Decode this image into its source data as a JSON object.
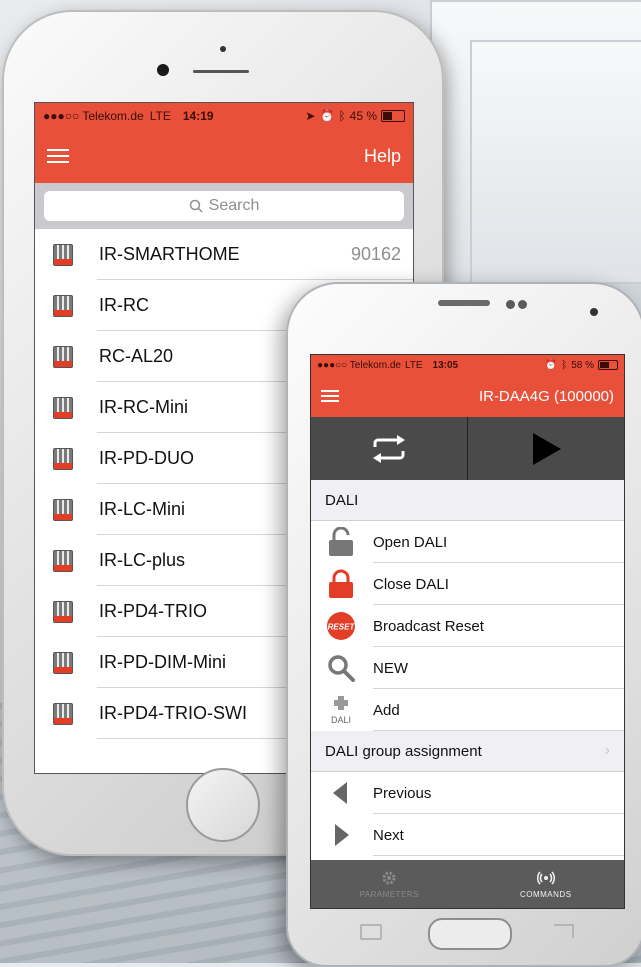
{
  "iphone": {
    "status": {
      "carrier": "●●●○○ Telekom.de",
      "network": "LTE",
      "time": "14:19",
      "battery": "45 %",
      "battery_level": 0.45
    },
    "nav": {
      "help": "Help"
    },
    "search": {
      "placeholder": "Search"
    },
    "list": [
      {
        "label": "IR-SMARTHOME",
        "count": "90162"
      },
      {
        "label": "IR-RC"
      },
      {
        "label": "RC-AL20"
      },
      {
        "label": "IR-RC-Mini"
      },
      {
        "label": "IR-PD-DUO"
      },
      {
        "label": "IR-LC-Mini"
      },
      {
        "label": "IR-LC-plus"
      },
      {
        "label": "IR-PD4-TRIO"
      },
      {
        "label": "IR-PD-DIM-Mini"
      },
      {
        "label": "IR-PD4-TRIO-SWI"
      }
    ]
  },
  "galaxy": {
    "status": {
      "carrier": "●●●○○ Telekom.de",
      "network": "LTE",
      "time": "13:05",
      "battery": "58 %",
      "battery_level": 0.58
    },
    "nav": {
      "title": "IR-DAA4G (100000)"
    },
    "section_dali": "DALI",
    "items": [
      {
        "label": "Open DALI",
        "icon": "lock-open-icon"
      },
      {
        "label": "Close DALI",
        "icon": "lock-closed-icon"
      },
      {
        "label": "Broadcast Reset",
        "icon": "reset-icon",
        "icon_text": "RESET"
      },
      {
        "label": "NEW",
        "icon": "search-icon"
      },
      {
        "label": "Add",
        "icon": "add-dali-icon",
        "icon_text": "DALI"
      }
    ],
    "section_group": "DALI group assignment",
    "nav_items": [
      {
        "label": "Previous",
        "icon": "triangle-left-icon"
      },
      {
        "label": "Next",
        "icon": "triangle-right-icon"
      }
    ],
    "tabs": [
      {
        "label": "PARAMETERS",
        "icon": "gear-icon"
      },
      {
        "label": "COMMANDS",
        "icon": "broadcast-icon"
      }
    ],
    "colors": {
      "accent": "#e8503a",
      "dark": "#4a4a4a"
    }
  }
}
